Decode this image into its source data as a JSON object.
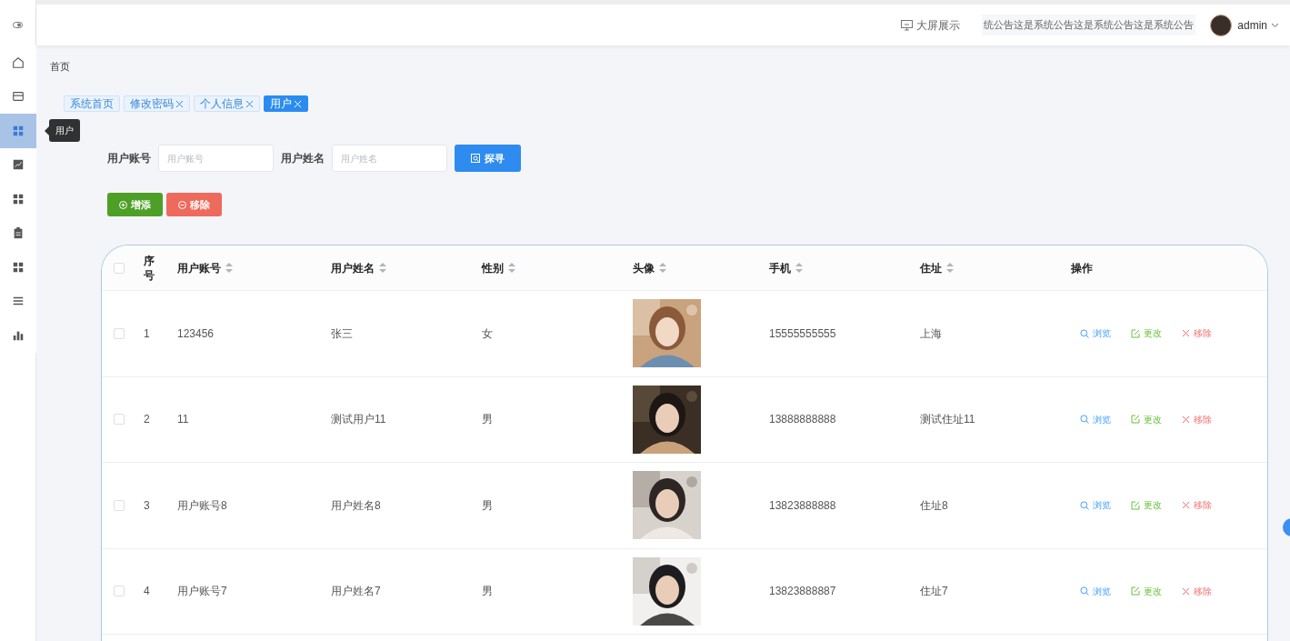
{
  "sidebar": {
    "items": [
      {
        "kind": "home",
        "selected": false
      },
      {
        "kind": "card",
        "selected": false
      },
      {
        "kind": "grid",
        "selected": true
      },
      {
        "kind": "trend",
        "selected": false
      },
      {
        "kind": "grid",
        "selected": false
      },
      {
        "kind": "clipboard",
        "selected": false
      },
      {
        "kind": "grid",
        "selected": false
      },
      {
        "kind": "list",
        "selected": false
      },
      {
        "kind": "bars",
        "selected": false
      }
    ],
    "tooltip": "用户"
  },
  "header": {
    "screen_link": "大屏展示",
    "notice": "统公告这是系统公告这是系统公告这是系统公告",
    "user": "admin"
  },
  "breadcrumb": "首页",
  "tags": [
    {
      "label": "系统首页",
      "closable": false,
      "selected": false
    },
    {
      "label": "修改密码",
      "closable": true,
      "selected": false
    },
    {
      "label": "个人信息",
      "closable": true,
      "selected": false
    },
    {
      "label": "用户",
      "closable": true,
      "selected": true
    }
  ],
  "search": {
    "fields": [
      {
        "label": "用户账号",
        "placeholder": "用户账号"
      },
      {
        "label": "用户姓名",
        "placeholder": "用户姓名"
      }
    ],
    "button": "探寻"
  },
  "toolbar": [
    {
      "kind": "add",
      "label": "增添"
    },
    {
      "kind": "delete",
      "label": "移除"
    }
  ],
  "table": {
    "select_all": {
      "checked": false
    },
    "columns": [
      {
        "label": "序号",
        "sortable": false
      },
      {
        "label": "用户账号",
        "sortable": true
      },
      {
        "label": "用户姓名",
        "sortable": true
      },
      {
        "label": "性别",
        "sortable": true
      },
      {
        "label": "头像",
        "sortable": true
      },
      {
        "label": "手机",
        "sortable": true
      },
      {
        "label": "住址",
        "sortable": true
      },
      {
        "label": "操作",
        "sortable": false
      }
    ],
    "rows": [
      {
        "checked": false,
        "index": "1",
        "account": "123456",
        "name": "张三",
        "gender": "女",
        "avatar": {
          "kind": "picture"
        },
        "phone": "15555555555",
        "address": "上海",
        "actions": [
          {
            "kind": "view",
            "label": "浏览"
          },
          {
            "kind": "edit",
            "label": "更改"
          },
          {
            "kind": "delete",
            "label": "移除"
          }
        ]
      },
      {
        "checked": false,
        "index": "2",
        "account": "11",
        "name": "测试用户11",
        "gender": "男",
        "avatar": {
          "kind": "picture"
        },
        "phone": "13888888888",
        "address": "测试住址11",
        "actions": [
          {
            "kind": "view",
            "label": "浏览"
          },
          {
            "kind": "edit",
            "label": "更改"
          },
          {
            "kind": "delete",
            "label": "移除"
          }
        ]
      },
      {
        "checked": false,
        "index": "3",
        "account": "用户账号8",
        "name": "用户姓名8",
        "gender": "男",
        "avatar": {
          "kind": "picture"
        },
        "phone": "13823888888",
        "address": "住址8",
        "actions": [
          {
            "kind": "view",
            "label": "浏览"
          },
          {
            "kind": "edit",
            "label": "更改"
          },
          {
            "kind": "delete",
            "label": "移除"
          }
        ]
      },
      {
        "checked": false,
        "index": "4",
        "account": "用户账号7",
        "name": "用户姓名7",
        "gender": "男",
        "avatar": {
          "kind": "picture"
        },
        "phone": "13823888887",
        "address": "住址7",
        "actions": [
          {
            "kind": "view",
            "label": "浏览"
          },
          {
            "kind": "edit",
            "label": "更改"
          },
          {
            "kind": "delete",
            "label": "移除"
          }
        ]
      }
    ]
  }
}
